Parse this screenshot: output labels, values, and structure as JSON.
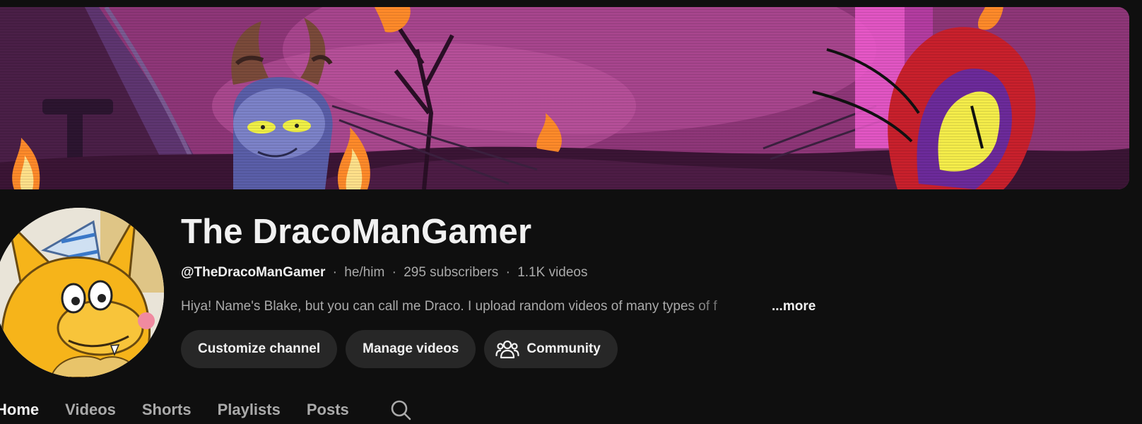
{
  "channel": {
    "title": "The DracoManGamer",
    "handle": "@TheDracoManGamer",
    "pronouns": "he/him",
    "subscribers": "295 subscribers",
    "videos": "1.1K videos",
    "separator": "·",
    "description": "Hiya! Name's Blake, but you can call me Draco. I upload random videos of many types of f",
    "more_label": "...more"
  },
  "actions": {
    "customize_label": "Customize channel",
    "manage_label": "Manage videos",
    "community_label": "Community",
    "community_icon": "people-icon"
  },
  "tabs": [
    {
      "label": "Home",
      "active": true
    },
    {
      "label": "Videos",
      "active": false
    },
    {
      "label": "Shorts",
      "active": false
    },
    {
      "label": "Playlists",
      "active": false
    },
    {
      "label": "Posts",
      "active": false
    }
  ],
  "search_icon": "search-icon",
  "colors": {
    "background": "#0f0f0f",
    "button": "#272727",
    "text_primary": "#f1f1f1",
    "text_secondary": "#aaaaaa",
    "avatar_yellow": "#f6b41a"
  }
}
